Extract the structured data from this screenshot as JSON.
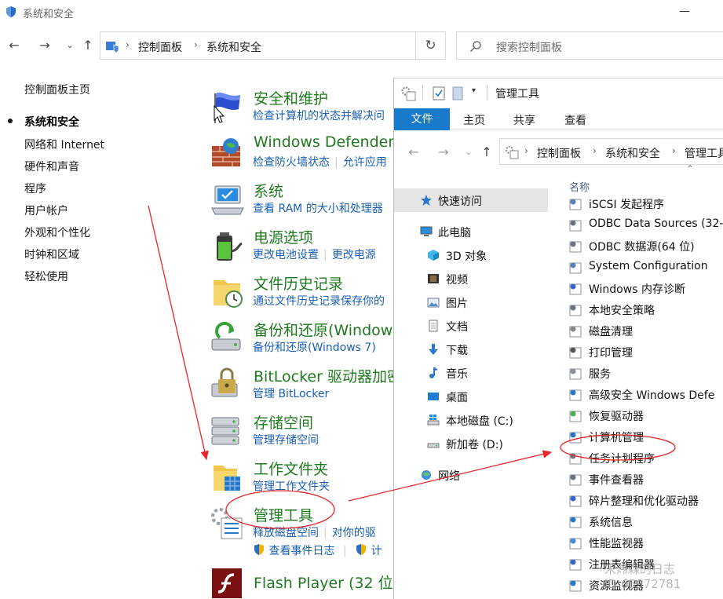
{
  "control_panel": {
    "window_title": "系统和安全",
    "breadcrumb": [
      "控制面板",
      "系统和安全"
    ],
    "search_placeholder": "搜索控制面板",
    "sidebar": [
      {
        "label": "控制面板主页",
        "selected": false
      },
      {
        "label": "系统和安全",
        "selected": true
      },
      {
        "label": "网络和 Internet",
        "selected": false
      },
      {
        "label": "硬件和声音",
        "selected": false
      },
      {
        "label": "程序",
        "selected": false
      },
      {
        "label": "用户帐户",
        "selected": false
      },
      {
        "label": "外观和个性化",
        "selected": false
      },
      {
        "label": "时钟和区域",
        "selected": false
      },
      {
        "label": "轻松使用",
        "selected": false
      }
    ],
    "categories": [
      {
        "title": "安全和维护",
        "links": [
          "检查计算机的状态并解决问"
        ],
        "icon": "flag-icon"
      },
      {
        "title": "Windows Defender",
        "links": [
          "检查防火墙状态",
          "允许应用"
        ],
        "icon": "firewall-icon"
      },
      {
        "title": "系统",
        "links": [
          "查看 RAM 的大小和处理器"
        ],
        "icon": "computer-icon"
      },
      {
        "title": "电源选项",
        "links": [
          "更改电池设置",
          "更改电源"
        ],
        "icon": "battery-icon"
      },
      {
        "title": "文件历史记录",
        "links": [
          "通过文件历史记录保存你的"
        ],
        "icon": "file-history-icon"
      },
      {
        "title": "备份和还原(Window",
        "links": [
          "备份和还原(Windows 7)"
        ],
        "icon": "backup-icon"
      },
      {
        "title": "BitLocker 驱动器加密",
        "links": [
          "管理 BitLocker"
        ],
        "icon": "bitlocker-icon"
      },
      {
        "title": "存储空间",
        "links": [
          "管理存储空间"
        ],
        "icon": "storage-icon"
      },
      {
        "title": "工作文件夹",
        "links": [
          "管理工作文件夹"
        ],
        "icon": "work-folders-icon"
      },
      {
        "title": "管理工具",
        "links": [
          "释放磁盘空间",
          "对你的驱"
        ],
        "sublinks": [
          "查看事件日志",
          "计"
        ],
        "icon": "admin-tools-icon"
      },
      {
        "title": "Flash Player (32 位)",
        "links": [],
        "icon": "flash-icon"
      }
    ]
  },
  "explorer": {
    "window_title": "管理工具",
    "ribbon_tabs": [
      "文件",
      "主页",
      "共享",
      "查看"
    ],
    "breadcrumb": [
      "控制面板",
      "系统和安全",
      "管理工具"
    ],
    "column_header": "名称",
    "nav_tree": [
      {
        "label": "快速访问",
        "icon": "star-icon",
        "selected": true
      },
      {
        "label": "此电脑",
        "icon": "pc-icon",
        "selected": false
      },
      {
        "label": "3D 对象",
        "icon": "cube-icon",
        "selected": false
      },
      {
        "label": "视频",
        "icon": "video-icon",
        "selected": false
      },
      {
        "label": "图片",
        "icon": "picture-icon",
        "selected": false
      },
      {
        "label": "文档",
        "icon": "document-icon",
        "selected": false
      },
      {
        "label": "下载",
        "icon": "download-icon",
        "selected": false
      },
      {
        "label": "音乐",
        "icon": "music-icon",
        "selected": false
      },
      {
        "label": "桌面",
        "icon": "desktop-icon",
        "selected": false
      },
      {
        "label": "本地磁盘 (C:)",
        "icon": "drive-c-icon",
        "selected": false
      },
      {
        "label": "新加卷 (D:)",
        "icon": "drive-d-icon",
        "selected": false
      },
      {
        "label": "网络",
        "icon": "network-icon",
        "selected": false
      }
    ],
    "items": [
      "iSCSI 发起程序",
      "ODBC Data Sources (32-",
      "ODBC 数据源(64 位)",
      "System Configuration",
      "Windows 内存诊断",
      "本地安全策略",
      "磁盘清理",
      "打印管理",
      "服务",
      "高级安全 Windows Defe",
      "恢复驱动器",
      "计算机管理",
      "任务计划程序",
      "事件查看器",
      "碎片整理和优化驱动器",
      "系统信息",
      "性能监视器",
      "注册表编辑器",
      "资源监视器"
    ]
  },
  "watermark": {
    "line1": "宋炜森的日志",
    "line2": "ID:65972781"
  },
  "colors": {
    "accent": "#1979ca",
    "category_title": "#1f7a1f",
    "link": "#1a5fb4",
    "annotation": "#e8262b"
  }
}
